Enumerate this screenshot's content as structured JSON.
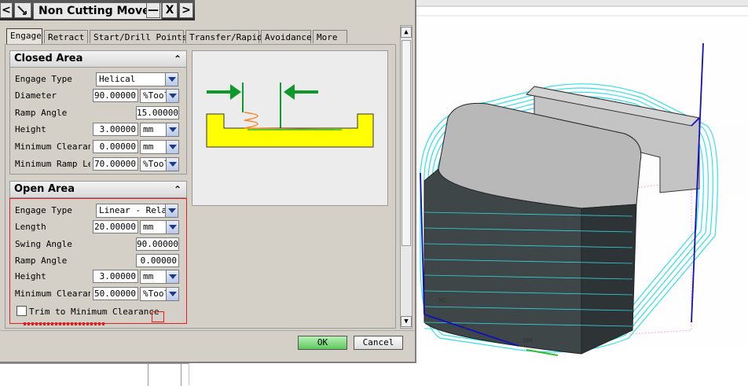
{
  "dialog": {
    "title": "Non Cutting Moves",
    "nav_left": "<",
    "nav_right": ">",
    "minimize": "—",
    "close": "X",
    "tabs": [
      "Engage",
      "Retract",
      "Start/Drill Points",
      "Transfer/Rapid",
      "Avoidance",
      "More"
    ],
    "active_tab": "Engage"
  },
  "closed_area": {
    "title": "Closed Area",
    "rows": [
      {
        "label": "Engage Type",
        "value": "Helical"
      },
      {
        "label": "Diameter",
        "value": "90.00000",
        "unit": "%Tool"
      },
      {
        "label": "Ramp Angle",
        "value": "15.00000"
      },
      {
        "label": "Height",
        "value": "3.00000",
        "unit": "mm"
      },
      {
        "label": "Minimum Clearance",
        "value": "0.00000",
        "unit": "mm"
      },
      {
        "label": "Minimum Ramp Length",
        "value": "70.00000",
        "unit": "%Tool"
      }
    ]
  },
  "open_area": {
    "title": "Open Area",
    "rows": [
      {
        "label": "Engage Type",
        "value": "Linear - Relative"
      },
      {
        "label": "Length",
        "value": "20.00000",
        "unit": "mm"
      },
      {
        "label": "Swing Angle",
        "value": "90.00000"
      },
      {
        "label": "Ramp Angle",
        "value": "0.00000"
      },
      {
        "label": "Height",
        "value": "3.00000",
        "unit": "mm"
      },
      {
        "label": "Minimum Clearance",
        "value": "50.00000",
        "unit": "%Tool"
      }
    ],
    "checkbox_label": "Trim to Minimum Clearance",
    "checkbox_checked": false
  },
  "buttons": {
    "ok": "OK",
    "cancel": "Cancel"
  },
  "colors": {
    "highlight_border": "#e02020",
    "toolpath": "#33e0e8",
    "axis": "#1010c0",
    "part": "#b8b8b8",
    "ok_button": "#78d078"
  }
}
